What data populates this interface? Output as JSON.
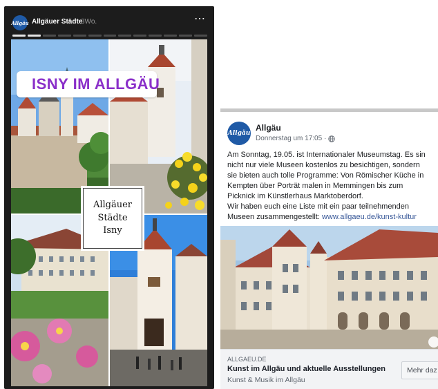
{
  "story": {
    "account_name": "Allgäuer Städte",
    "time_ago": "3Wo.",
    "avatar_text": "Allgäu",
    "more_icon": "more-horizontal-icon",
    "progress_total": 13,
    "progress_done": 2,
    "location_sticker": "ISNY IM ALLGÄU",
    "caption_lines": [
      "Allgäuer",
      "Städte",
      "Isny"
    ]
  },
  "post": {
    "avatar_text": "Allgäu",
    "page_name": "Allgäu",
    "timestamp": "Donnerstag um 17:05 ·",
    "privacy_icon": "globe-icon",
    "text_lines": [
      "Am Sonntag, 19.05. ist Internationaler Museumstag. Es sin",
      "nicht nur viele Museen kostenlos zu besichtigen, sondern",
      "sie bieten auch tolle Programme: Von Römischer Küche in",
      "Kempten über Porträt malen in Memmingen bis zum",
      "Picknick im Künstlerhaus Marktoberdorf.",
      "Wir haben euch eine Liste mit ein paar teilnehmenden"
    ],
    "last_line_text": "Museen zusammengestellt: ",
    "link_text": "www.allgaeu.de/kunst-kultur",
    "link_card": {
      "domain": "ALLGAEU.DE",
      "title": "Kunst im Allgäu und aktuelle Ausstellungen",
      "description": "Kunst & Musik im Allgäu",
      "button_label": "Mehr daz"
    }
  },
  "colors": {
    "story_bg": "#1c1c1c",
    "sticker_text": "#8a2fc9",
    "brand_blue": "#1f5aa6",
    "link": "#385898"
  }
}
